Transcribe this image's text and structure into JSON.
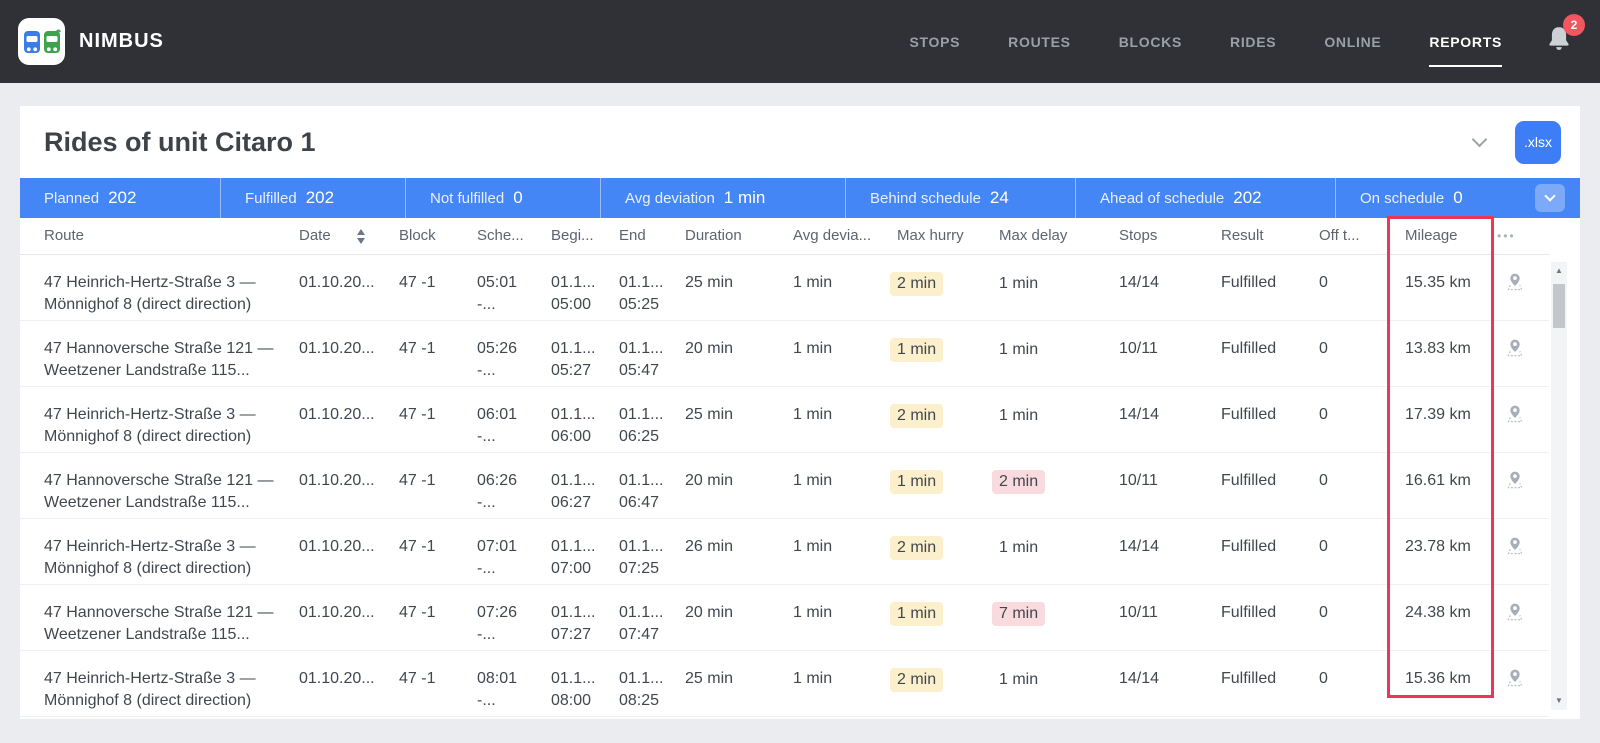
{
  "header": {
    "brand": "NIMBUS",
    "nav": [
      {
        "label": "STOPS"
      },
      {
        "label": "ROUTES"
      },
      {
        "label": "BLOCKS"
      },
      {
        "label": "RIDES"
      },
      {
        "label": "ONLINE"
      },
      {
        "label": "REPORTS"
      }
    ],
    "active_nav": "REPORTS",
    "notification_count": "2"
  },
  "report": {
    "title": "Rides of unit Citaro 1",
    "export_label": ".xlsx"
  },
  "summary": {
    "items": [
      {
        "label": "Planned",
        "value": "202"
      },
      {
        "label": "Fulfilled",
        "value": "202"
      },
      {
        "label": "Not fulfilled",
        "value": "0"
      },
      {
        "label": "Avg deviation",
        "value": "1 min"
      },
      {
        "label": "Behind schedule",
        "value": "24"
      },
      {
        "label": "Ahead of schedule",
        "value": "202"
      },
      {
        "label": "On schedule",
        "value": "0"
      }
    ]
  },
  "table": {
    "columns": [
      "Route",
      "Date",
      "Block",
      "Sche...",
      "Begi...",
      "End",
      "Duration",
      "Avg devia...",
      "Max hurry",
      "Max delay",
      "Stops",
      "Result",
      "Off t...",
      "Mileage"
    ],
    "rows": [
      {
        "route_line1": "47 Heinrich-Hertz-Straße 3 —",
        "route_line2": "Mönnighof 8 (direct direction)",
        "date": "01.10.20...",
        "block": "47 -1",
        "schedule_line1": "05:01",
        "schedule_line2": "-...",
        "begin_line1": "01.1...",
        "begin_line2": "05:00",
        "end_line1": "01.1...",
        "end_line2": "05:25",
        "duration": "25 min",
        "avg_deviation": "1 min",
        "max_hurry": "2 min",
        "max_hurry_highlight": "amber",
        "max_delay": "1 min",
        "max_delay_highlight": "none",
        "stops": "14/14",
        "result": "Fulfilled",
        "off_track": "0",
        "mileage": "15.35 km"
      },
      {
        "route_line1": "47 Hannoversche Straße 121 —",
        "route_line2": "Weetzener Landstraße 115...",
        "date": "01.10.20...",
        "block": "47 -1",
        "schedule_line1": "05:26",
        "schedule_line2": "-...",
        "begin_line1": "01.1...",
        "begin_line2": "05:27",
        "end_line1": "01.1...",
        "end_line2": "05:47",
        "duration": "20 min",
        "avg_deviation": "1 min",
        "max_hurry": "1 min",
        "max_hurry_highlight": "amber",
        "max_delay": "1 min",
        "max_delay_highlight": "none",
        "stops": "10/11",
        "result": "Fulfilled",
        "off_track": "0",
        "mileage": "13.83 km"
      },
      {
        "route_line1": "47 Heinrich-Hertz-Straße 3 —",
        "route_line2": "Mönnighof 8 (direct direction)",
        "date": "01.10.20...",
        "block": "47 -1",
        "schedule_line1": "06:01",
        "schedule_line2": "-...",
        "begin_line1": "01.1...",
        "begin_line2": "06:00",
        "end_line1": "01.1...",
        "end_line2": "06:25",
        "duration": "25 min",
        "avg_deviation": "1 min",
        "max_hurry": "2 min",
        "max_hurry_highlight": "amber",
        "max_delay": "1 min",
        "max_delay_highlight": "none",
        "stops": "14/14",
        "result": "Fulfilled",
        "off_track": "0",
        "mileage": "17.39 km"
      },
      {
        "route_line1": "47 Hannoversche Straße 121 —",
        "route_line2": "Weetzener Landstraße 115...",
        "date": "01.10.20...",
        "block": "47 -1",
        "schedule_line1": "06:26",
        "schedule_line2": "-...",
        "begin_line1": "01.1...",
        "begin_line2": "06:27",
        "end_line1": "01.1...",
        "end_line2": "06:47",
        "duration": "20 min",
        "avg_deviation": "1 min",
        "max_hurry": "1 min",
        "max_hurry_highlight": "amber",
        "max_delay": "2 min",
        "max_delay_highlight": "pink",
        "stops": "10/11",
        "result": "Fulfilled",
        "off_track": "0",
        "mileage": "16.61 km"
      },
      {
        "route_line1": "47 Heinrich-Hertz-Straße 3 —",
        "route_line2": "Mönnighof 8 (direct direction)",
        "date": "01.10.20...",
        "block": "47 -1",
        "schedule_line1": "07:01",
        "schedule_line2": "-...",
        "begin_line1": "01.1...",
        "begin_line2": "07:00",
        "end_line1": "01.1...",
        "end_line2": "07:25",
        "duration": "26 min",
        "avg_deviation": "1 min",
        "max_hurry": "2 min",
        "max_hurry_highlight": "amber",
        "max_delay": "1 min",
        "max_delay_highlight": "none",
        "stops": "14/14",
        "result": "Fulfilled",
        "off_track": "0",
        "mileage": "23.78 km"
      },
      {
        "route_line1": "47 Hannoversche Straße 121 —",
        "route_line2": "Weetzener Landstraße 115...",
        "date": "01.10.20...",
        "block": "47 -1",
        "schedule_line1": "07:26",
        "schedule_line2": "-...",
        "begin_line1": "01.1...",
        "begin_line2": "07:27",
        "end_line1": "01.1...",
        "end_line2": "07:47",
        "duration": "20 min",
        "avg_deviation": "1 min",
        "max_hurry": "1 min",
        "max_hurry_highlight": "amber",
        "max_delay": "7 min",
        "max_delay_highlight": "pink",
        "stops": "10/11",
        "result": "Fulfilled",
        "off_track": "0",
        "mileage": "24.38 km"
      },
      {
        "route_line1": "47 Heinrich-Hertz-Straße 3 —",
        "route_line2": "Mönnighof 8 (direct direction)",
        "date": "01.10.20...",
        "block": "47 -1",
        "schedule_line1": "08:01",
        "schedule_line2": "-...",
        "begin_line1": "01.1...",
        "begin_line2": "08:00",
        "end_line1": "01.1...",
        "end_line2": "08:25",
        "duration": "25 min",
        "avg_deviation": "1 min",
        "max_hurry": "2 min",
        "max_hurry_highlight": "amber",
        "max_delay": "1 min",
        "max_delay_highlight": "none",
        "stops": "14/14",
        "result": "Fulfilled",
        "off_track": "0",
        "mileage": "15.36 km"
      }
    ]
  },
  "colors": {
    "header_dark": "#2f3136",
    "accent_blue": "#4486f5",
    "export_button_blue": "#3d7ef6",
    "badge_red": "#f4555e",
    "mileage_highlight_red": "#f0335b",
    "hurry_chip_amber": "#fcefcb",
    "delay_chip_pink": "#f9dade"
  }
}
